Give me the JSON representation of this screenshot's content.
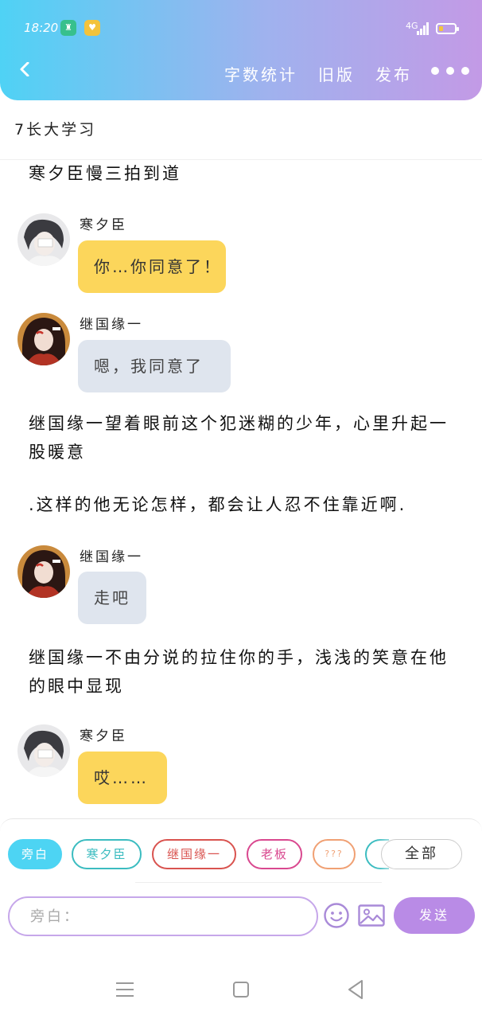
{
  "status_bar": {
    "time": "18:20",
    "network": "4G",
    "app_icon_1": "app-icon",
    "app_icon_2": "heart-icon"
  },
  "header": {
    "back_icon": "chevron-left-icon",
    "actions": [
      "字数统计",
      "旧版",
      "发布"
    ],
    "more_icon": "more-dots-icon",
    "gradient": [
      "#4fd2f5",
      "#c39ae6"
    ]
  },
  "story": {
    "title": "7长大学习"
  },
  "messages": [
    {
      "type": "narration",
      "text": "寒夕臣慢三拍到道"
    },
    {
      "type": "chat",
      "speaker": "寒夕臣",
      "text": "你…你同意了！",
      "bubble_color": "#fcd65b",
      "avatar_icon": "avatar-hanxichen"
    },
    {
      "type": "chat",
      "speaker": "继国缘一",
      "text": "嗯，我同意了",
      "bubble_color": "#dfe5ee",
      "avatar_icon": "avatar-jiguoyuanyi"
    },
    {
      "type": "narration",
      "text": "继国缘一望着眼前这个犯迷糊的少年，心里升起一股暖意"
    },
    {
      "type": "narration",
      "text": ".这样的他无论怎样，都会让人忍不住靠近啊."
    },
    {
      "type": "chat",
      "speaker": "继国缘一",
      "text": "走吧",
      "bubble_color": "#dfe5ee",
      "avatar_icon": "avatar-jiguoyuanyi"
    },
    {
      "type": "narration",
      "text": "继国缘一不由分说的拉住你的手，浅浅的笑意在他的眼中显现"
    },
    {
      "type": "chat",
      "speaker": "寒夕臣",
      "text": "哎……",
      "bubble_color": "#fcd65b",
      "avatar_icon": "avatar-hanxichen"
    }
  ],
  "role_chips": [
    {
      "label": "旁白",
      "color": "#4dd4f3",
      "active": true
    },
    {
      "label": "寒夕臣",
      "color": "#3bbcc0",
      "active": false
    },
    {
      "label": "继国缘一",
      "color": "#d9534f",
      "active": false
    },
    {
      "label": "老板",
      "color": "#d9488f",
      "active": false
    },
    {
      "label": "???",
      "color": "#f0a073",
      "active": false
    }
  ],
  "all_button": "全部",
  "composer": {
    "placeholder": "旁白：",
    "emoji_icon": "smiley-icon",
    "image_icon": "image-icon",
    "send_label": "发送",
    "send_color": "#b98be6"
  },
  "system_nav": [
    "menu-icon",
    "home-icon",
    "back-triangle-icon"
  ]
}
